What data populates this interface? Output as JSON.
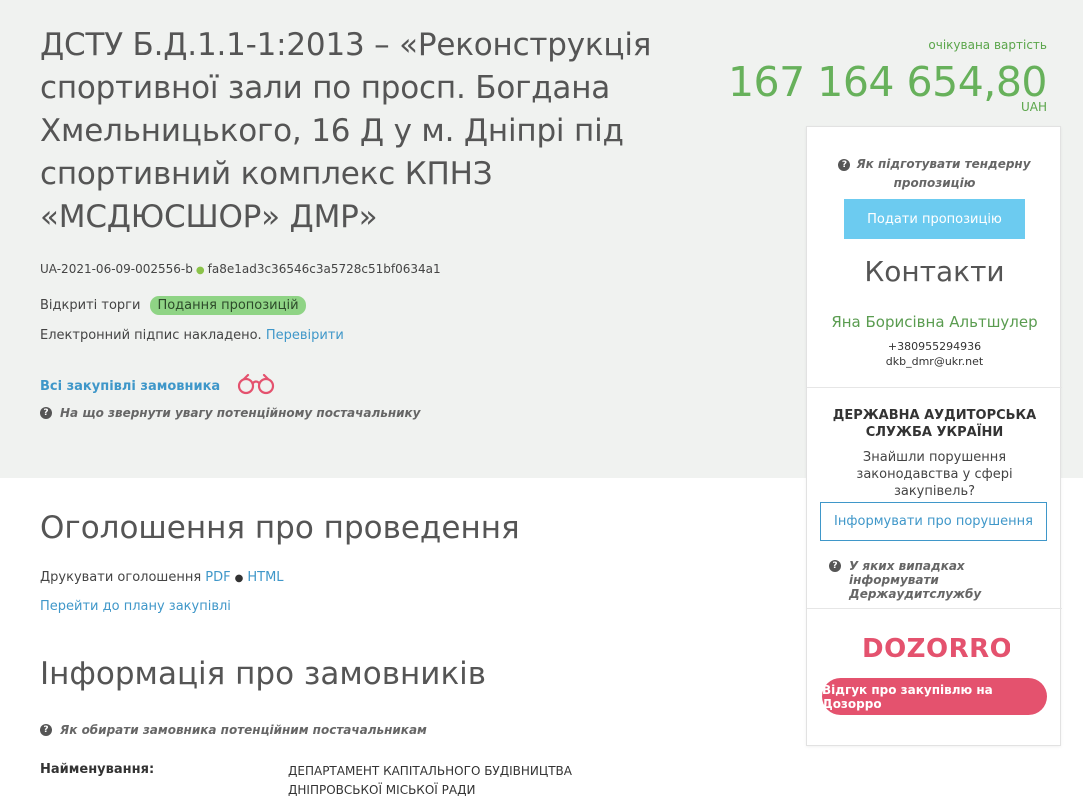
{
  "tender": {
    "title": "ДСТУ Б.Д.1.1-1:2013 – «Реконструкція спортивної зали по просп. Богдана Хмельницького, 16 Д у м. Дніпрі під спортивний комплекс КПНЗ «МСДЮСШОР» ДМР»",
    "id": "UA-2021-06-09-002556-b",
    "hash": "fa8e1ad3c36546c3a5728c51bf0634a1",
    "procurement_type": "Відкриті торги",
    "status": "Подання пропозицій",
    "signature_text": "Електронний підпис накладено.",
    "verify_link": "Перевірити",
    "all_purchases_link": "Всі закупівлі замовника",
    "supplier_hint": "На що звернути увагу потенційному постачальнику"
  },
  "price": {
    "label": "очікувана вартість",
    "value": "167 164 654,80",
    "currency": "UAH"
  },
  "sidebar": {
    "prepare_hint": "Як підготувати тендерну пропозицію",
    "submit_button": "Подати пропозицію",
    "contacts_title": "Контакти",
    "contact_name": "Яна Борисівна Альтшулер",
    "contact_phone": "+380955294936",
    "contact_email": "dkb_dmr@ukr.net",
    "das_title": "ДЕРЖАВНА АУДИТОРСЬКА СЛУЖБА УКРАЇНИ",
    "das_question": "Знайшли порушення законодавства у сфері закупівель?",
    "report_button": "Інформувати про порушення",
    "das_hint": "У яких випадках інформувати Держаудитслужбу",
    "dozorro_logo": "DOZORRO",
    "dozorro_button": "Відгук про закупівлю на Дозорро"
  },
  "announcement": {
    "title": "Оголошення про проведення",
    "print_label": "Друкувати оголошення",
    "pdf_link": "PDF",
    "html_link": "HTML",
    "plan_link": "Перейти до плану закупівлі"
  },
  "customers": {
    "title": "Інформація про замовників",
    "hint": "Як обирати замовника потенційним постачальникам",
    "name_label": "Найменування:",
    "name_value": "ДЕПАРТАМЕНТ КАПІТАЛЬНОГО БУДІВНИЦТВА ДНІПРОВСЬКОЇ МІСЬКОЇ РАДИ"
  },
  "colors": {
    "hero_bg": "#f0f2f0",
    "price_green": "#67b15b",
    "link_blue": "#3f97c9",
    "submit_blue": "#6ccbf0",
    "dozorro_pink": "#e4526e",
    "status_green": "#8fd485"
  }
}
